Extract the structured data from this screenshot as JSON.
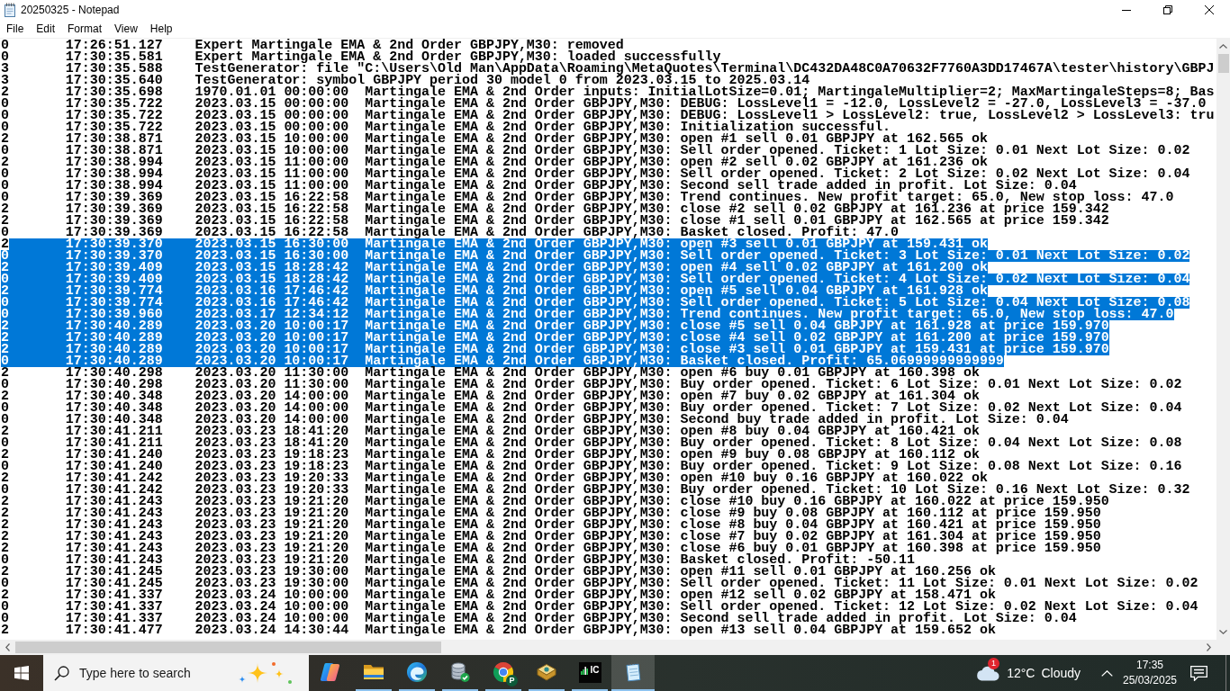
{
  "window": {
    "title": "20250325 - Notepad"
  },
  "menu": [
    "File",
    "Edit",
    "Format",
    "View",
    "Help"
  ],
  "editor": {
    "lines": [
      {
        "code": "0",
        "time": "17:26:51.127",
        "text": "Expert Martingale EMA & 2nd Order GBPJPY,M30: removed",
        "selected": false
      },
      {
        "code": "0",
        "time": "17:30:35.581",
        "text": "Expert Martingale EMA & 2nd Order GBPJPY,M30: loaded successfully",
        "selected": false
      },
      {
        "code": "3",
        "time": "17:30:35.588",
        "text": "TestGenerator: file \"C:\\Users\\Old Man\\AppData\\Roaming\\MetaQuotes\\Terminal\\DC432DA48C0A70632F7760A3DD17467A\\tester\\history\\GBPJ",
        "selected": false
      },
      {
        "code": "3",
        "time": "17:30:35.640",
        "text": "TestGenerator: symbol GBPJPY period 30 model 0 from 2023.03.15 to 2025.03.14",
        "selected": false
      },
      {
        "code": "2",
        "time": "17:30:35.698",
        "text": "1970.01.01 00:00:00  Martingale EMA & 2nd Order inputs: InitialLotSize=0.01; MartingaleMultiplier=2; MaxMartingaleSteps=8; Bas",
        "selected": false
      },
      {
        "code": "0",
        "time": "17:30:35.722",
        "text": "2023.03.15 00:00:00  Martingale EMA & 2nd Order GBPJPY,M30: DEBUG: LossLevel1 = -12.0, LossLevel2 = -27.0, LossLevel3 = -37.0",
        "selected": false
      },
      {
        "code": "0",
        "time": "17:30:35.722",
        "text": "2023.03.15 00:00:00  Martingale EMA & 2nd Order GBPJPY,M30: DEBUG: LossLevel1 > LossLevel2: true, LossLevel2 > LossLevel3: tru",
        "selected": false
      },
      {
        "code": "0",
        "time": "17:30:35.722",
        "text": "2023.03.15 00:00:00  Martingale EMA & 2nd Order GBPJPY,M30: Initialization successful.",
        "selected": false
      },
      {
        "code": "2",
        "time": "17:30:38.871",
        "text": "2023.03.15 10:00:00  Martingale EMA & 2nd Order GBPJPY,M30: open #1 sell 0.01 GBPJPY at 162.565 ok",
        "selected": false
      },
      {
        "code": "0",
        "time": "17:30:38.871",
        "text": "2023.03.15 10:00:00  Martingale EMA & 2nd Order GBPJPY,M30: Sell order opened. Ticket: 1 Lot Size: 0.01 Next Lot Size: 0.02",
        "selected": false
      },
      {
        "code": "2",
        "time": "17:30:38.994",
        "text": "2023.03.15 11:00:00  Martingale EMA & 2nd Order GBPJPY,M30: open #2 sell 0.02 GBPJPY at 161.236 ok",
        "selected": false
      },
      {
        "code": "0",
        "time": "17:30:38.994",
        "text": "2023.03.15 11:00:00  Martingale EMA & 2nd Order GBPJPY,M30: Sell order opened. Ticket: 2 Lot Size: 0.02 Next Lot Size: 0.04",
        "selected": false
      },
      {
        "code": "0",
        "time": "17:30:38.994",
        "text": "2023.03.15 11:00:00  Martingale EMA & 2nd Order GBPJPY,M30: Second sell trade added in profit. Lot Size: 0.04",
        "selected": false
      },
      {
        "code": "0",
        "time": "17:30:39.369",
        "text": "2023.03.15 16:22:58  Martingale EMA & 2nd Order GBPJPY,M30: Trend continues. New profit target: 65.0, New stop loss: 47.0",
        "selected": false
      },
      {
        "code": "2",
        "time": "17:30:39.369",
        "text": "2023.03.15 16:22:58  Martingale EMA & 2nd Order GBPJPY,M30: close #2 sell 0.02 GBPJPY at 161.236 at price 159.342",
        "selected": false
      },
      {
        "code": "2",
        "time": "17:30:39.369",
        "text": "2023.03.15 16:22:58  Martingale EMA & 2nd Order GBPJPY,M30: close #1 sell 0.01 GBPJPY at 162.565 at price 159.342",
        "selected": false
      },
      {
        "code": "0",
        "time": "17:30:39.369",
        "text": "2023.03.15 16:22:58  Martingale EMA & 2nd Order GBPJPY,M30: Basket closed. Profit: 47.0",
        "selected": false
      },
      {
        "code": "2",
        "time": "17:30:39.370",
        "text": "2023.03.15 16:30:00  Martingale EMA & 2nd Order GBPJPY,M30: open #3 sell 0.01 GBPJPY at 159.431 ok",
        "selected": true
      },
      {
        "code": "0",
        "time": "17:30:39.370",
        "text": "2023.03.15 16:30:00  Martingale EMA & 2nd Order GBPJPY,M30: Sell order opened. Ticket: 3 Lot Size: 0.01 Next Lot Size: 0.02",
        "selected": true
      },
      {
        "code": "2",
        "time": "17:30:39.409",
        "text": "2023.03.15 18:28:42  Martingale EMA & 2nd Order GBPJPY,M30: open #4 sell 0.02 GBPJPY at 161.200 ok",
        "selected": true
      },
      {
        "code": "0",
        "time": "17:30:39.409",
        "text": "2023.03.15 18:28:42  Martingale EMA & 2nd Order GBPJPY,M30: Sell order opened. Ticket: 4 Lot Size: 0.02 Next Lot Size: 0.04",
        "selected": true
      },
      {
        "code": "2",
        "time": "17:30:39.774",
        "text": "2023.03.16 17:46:42  Martingale EMA & 2nd Order GBPJPY,M30: open #5 sell 0.04 GBPJPY at 161.928 ok",
        "selected": true
      },
      {
        "code": "0",
        "time": "17:30:39.774",
        "text": "2023.03.16 17:46:42  Martingale EMA & 2nd Order GBPJPY,M30: Sell order opened. Ticket: 5 Lot Size: 0.04 Next Lot Size: 0.08",
        "selected": true
      },
      {
        "code": "0",
        "time": "17:30:39.960",
        "text": "2023.03.17 12:34:12  Martingale EMA & 2nd Order GBPJPY,M30: Trend continues. New profit target: 65.0, New stop loss: 47.0",
        "selected": true
      },
      {
        "code": "2",
        "time": "17:30:40.289",
        "text": "2023.03.20 10:00:17  Martingale EMA & 2nd Order GBPJPY,M30: close #5 sell 0.04 GBPJPY at 161.928 at price 159.970",
        "selected": true
      },
      {
        "code": "2",
        "time": "17:30:40.289",
        "text": "2023.03.20 10:00:17  Martingale EMA & 2nd Order GBPJPY,M30: close #4 sell 0.02 GBPJPY at 161.200 at price 159.970",
        "selected": true
      },
      {
        "code": "2",
        "time": "17:30:40.289",
        "text": "2023.03.20 10:00:17  Martingale EMA & 2nd Order GBPJPY,M30: close #3 sell 0.01 GBPJPY at 159.431 at price 159.970",
        "selected": true
      },
      {
        "code": "0",
        "time": "17:30:40.289",
        "text": "2023.03.20 10:00:17  Martingale EMA & 2nd Order GBPJPY,M30: Basket closed. Profit: 65.06999999999999",
        "selected": true
      },
      {
        "code": "2",
        "time": "17:30:40.298",
        "text": "2023.03.20 11:30:00  Martingale EMA & 2nd Order GBPJPY,M30: open #6 buy 0.01 GBPJPY at 160.398 ok",
        "selected": false
      },
      {
        "code": "0",
        "time": "17:30:40.298",
        "text": "2023.03.20 11:30:00  Martingale EMA & 2nd Order GBPJPY,M30: Buy order opened. Ticket: 6 Lot Size: 0.01 Next Lot Size: 0.02",
        "selected": false
      },
      {
        "code": "2",
        "time": "17:30:40.348",
        "text": "2023.03.20 14:00:00  Martingale EMA & 2nd Order GBPJPY,M30: open #7 buy 0.02 GBPJPY at 161.304 ok",
        "selected": false
      },
      {
        "code": "0",
        "time": "17:30:40.348",
        "text": "2023.03.20 14:00:00  Martingale EMA & 2nd Order GBPJPY,M30: Buy order opened. Ticket: 7 Lot Size: 0.02 Next Lot Size: 0.04",
        "selected": false
      },
      {
        "code": "0",
        "time": "17:30:40.348",
        "text": "2023.03.20 14:00:00  Martingale EMA & 2nd Order GBPJPY,M30: Second buy trade added in profit. Lot Size: 0.04",
        "selected": false
      },
      {
        "code": "2",
        "time": "17:30:41.211",
        "text": "2023.03.23 18:41:20  Martingale EMA & 2nd Order GBPJPY,M30: open #8 buy 0.04 GBPJPY at 160.421 ok",
        "selected": false
      },
      {
        "code": "0",
        "time": "17:30:41.211",
        "text": "2023.03.23 18:41:20  Martingale EMA & 2nd Order GBPJPY,M30: Buy order opened. Ticket: 8 Lot Size: 0.04 Next Lot Size: 0.08",
        "selected": false
      },
      {
        "code": "2",
        "time": "17:30:41.240",
        "text": "2023.03.23 19:18:23  Martingale EMA & 2nd Order GBPJPY,M30: open #9 buy 0.08 GBPJPY at 160.112 ok",
        "selected": false
      },
      {
        "code": "0",
        "time": "17:30:41.240",
        "text": "2023.03.23 19:18:23  Martingale EMA & 2nd Order GBPJPY,M30: Buy order opened. Ticket: 9 Lot Size: 0.08 Next Lot Size: 0.16",
        "selected": false
      },
      {
        "code": "2",
        "time": "17:30:41.242",
        "text": "2023.03.23 19:20:33  Martingale EMA & 2nd Order GBPJPY,M30: open #10 buy 0.16 GBPJPY at 160.022 ok",
        "selected": false
      },
      {
        "code": "0",
        "time": "17:30:41.242",
        "text": "2023.03.23 19:20:33  Martingale EMA & 2nd Order GBPJPY,M30: Buy order opened. Ticket: 10 Lot Size: 0.16 Next Lot Size: 0.32",
        "selected": false
      },
      {
        "code": "2",
        "time": "17:30:41.243",
        "text": "2023.03.23 19:21:20  Martingale EMA & 2nd Order GBPJPY,M30: close #10 buy 0.16 GBPJPY at 160.022 at price 159.950",
        "selected": false
      },
      {
        "code": "2",
        "time": "17:30:41.243",
        "text": "2023.03.23 19:21:20  Martingale EMA & 2nd Order GBPJPY,M30: close #9 buy 0.08 GBPJPY at 160.112 at price 159.950",
        "selected": false
      },
      {
        "code": "2",
        "time": "17:30:41.243",
        "text": "2023.03.23 19:21:20  Martingale EMA & 2nd Order GBPJPY,M30: close #8 buy 0.04 GBPJPY at 160.421 at price 159.950",
        "selected": false
      },
      {
        "code": "2",
        "time": "17:30:41.243",
        "text": "2023.03.23 19:21:20  Martingale EMA & 2nd Order GBPJPY,M30: close #7 buy 0.02 GBPJPY at 161.304 at price 159.950",
        "selected": false
      },
      {
        "code": "2",
        "time": "17:30:41.243",
        "text": "2023.03.23 19:21:20  Martingale EMA & 2nd Order GBPJPY,M30: close #6 buy 0.01 GBPJPY at 160.398 at price 159.950",
        "selected": false
      },
      {
        "code": "0",
        "time": "17:30:41.243",
        "text": "2023.03.23 19:21:20  Martingale EMA & 2nd Order GBPJPY,M30: Basket closed. Profit: -50.11",
        "selected": false
      },
      {
        "code": "2",
        "time": "17:30:41.245",
        "text": "2023.03.23 19:30:00  Martingale EMA & 2nd Order GBPJPY,M30: open #11 sell 0.01 GBPJPY at 160.256 ok",
        "selected": false
      },
      {
        "code": "0",
        "time": "17:30:41.245",
        "text": "2023.03.23 19:30:00  Martingale EMA & 2nd Order GBPJPY,M30: Sell order opened. Ticket: 11 Lot Size: 0.01 Next Lot Size: 0.02",
        "selected": false
      },
      {
        "code": "2",
        "time": "17:30:41.337",
        "text": "2023.03.24 10:00:00  Martingale EMA & 2nd Order GBPJPY,M30: open #12 sell 0.02 GBPJPY at 158.471 ok",
        "selected": false
      },
      {
        "code": "0",
        "time": "17:30:41.337",
        "text": "2023.03.24 10:00:00  Martingale EMA & 2nd Order GBPJPY,M30: Sell order opened. Ticket: 12 Lot Size: 0.02 Next Lot Size: 0.04",
        "selected": false
      },
      {
        "code": "0",
        "time": "17:30:41.337",
        "text": "2023.03.24 10:00:00  Martingale EMA & 2nd Order GBPJPY,M30: Second sell trade added in profit. Lot Size: 0.04",
        "selected": false
      },
      {
        "code": "2",
        "time": "17:30:41.477",
        "text": "2023.03.24 14:30:44  Martingale EMA & 2nd Order GBPJPY,M30: open #13 sell 0.04 GBPJPY at 159.652 ok",
        "selected": false
      }
    ]
  },
  "taskbar": {
    "search": {
      "placeholder": "Type here to search"
    },
    "apps": [
      {
        "kind": "ribbon",
        "running": false,
        "selected": false
      },
      {
        "kind": "folder",
        "running": true,
        "selected": false
      },
      {
        "kind": "swirl",
        "running": true,
        "selected": false
      },
      {
        "kind": "database",
        "running": true,
        "selected": false
      },
      {
        "kind": "wheel",
        "running": true,
        "selected": false,
        "badge": "P"
      },
      {
        "kind": "book",
        "running": true,
        "selected": false
      },
      {
        "kind": "bars",
        "running": true,
        "selected": false,
        "label": "IC"
      },
      {
        "kind": "notepad",
        "running": true,
        "selected": true
      }
    ],
    "weather": {
      "alert_count": "1",
      "temperature": "12°C",
      "condition": "Cloudy"
    },
    "clock": {
      "time": "17:35",
      "date": "25/03/2025"
    }
  }
}
